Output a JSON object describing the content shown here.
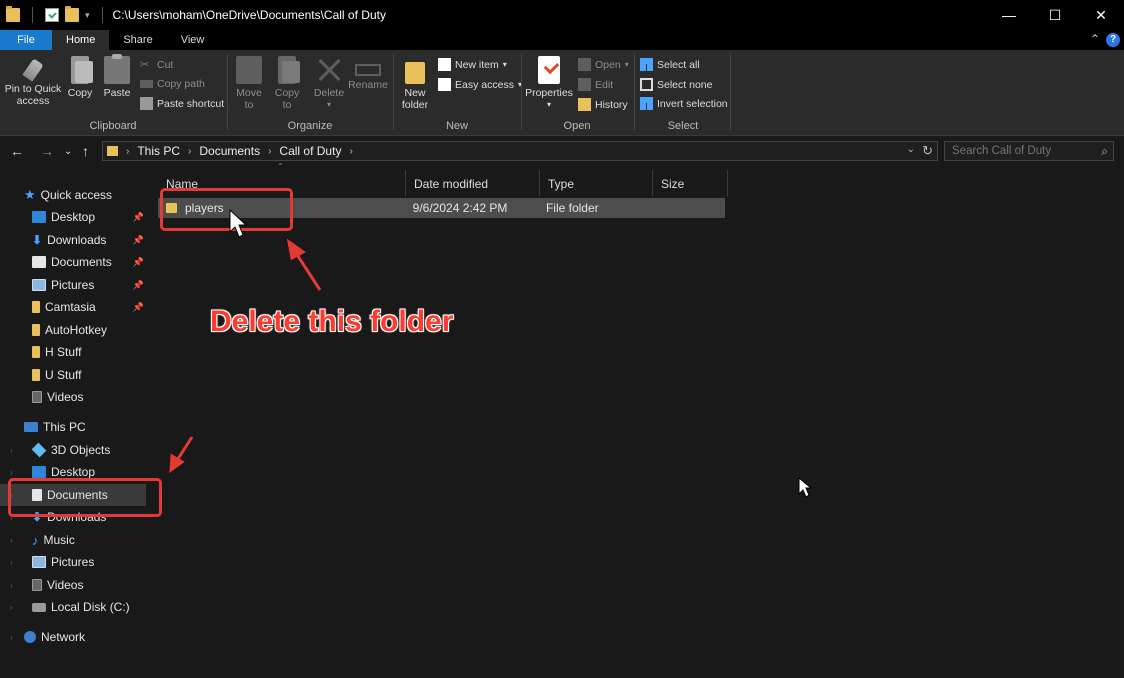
{
  "window": {
    "path": "C:\\Users\\moham\\OneDrive\\Documents\\Call of Duty",
    "controls": [
      "—",
      "☐",
      "✕"
    ]
  },
  "tabs": [
    "File",
    "Home",
    "Share",
    "View"
  ],
  "ribbon": {
    "clipboard": {
      "label": "Clipboard",
      "pin_line1": "Pin to Quick",
      "pin_line2": "access",
      "copy": "Copy",
      "paste": "Paste",
      "cut": "Cut",
      "copy_path": "Copy path",
      "paste_shortcut": "Paste shortcut"
    },
    "organize": {
      "label": "Organize",
      "move_line1": "Move",
      "move_line2": "to",
      "copy_line1": "Copy",
      "copy_line2": "to",
      "delete": "Delete",
      "rename": "Rename"
    },
    "new": {
      "label": "New",
      "folder_line1": "New",
      "folder_line2": "folder",
      "new_item": "New item",
      "easy_access": "Easy access"
    },
    "open": {
      "label": "Open",
      "properties": "Properties",
      "open": "Open",
      "edit": "Edit",
      "history": "History"
    },
    "select": {
      "label": "Select",
      "select_all": "Select all",
      "select_none": "Select none",
      "invert": "Invert selection"
    }
  },
  "address": {
    "crumbs": [
      "This PC",
      "Documents",
      "Call of Duty"
    ],
    "search_placeholder": "Search Call of Duty"
  },
  "nav": {
    "quick_access": "Quick access",
    "quick_items": [
      "Desktop",
      "Downloads",
      "Documents",
      "Pictures",
      "Camtasia",
      "AutoHotkey",
      "H Stuff",
      "U Stuff",
      "Videos"
    ],
    "this_pc": "This PC",
    "pc_items": [
      "3D Objects",
      "Desktop",
      "Documents",
      "Downloads",
      "Music",
      "Pictures",
      "Videos",
      "Local Disk (C:)"
    ],
    "network": "Network"
  },
  "columns": [
    "Name",
    "Date modified",
    "Type",
    "Size"
  ],
  "files": [
    {
      "name": "players",
      "modified": "9/6/2024 2:42 PM",
      "type": "File folder",
      "size": ""
    }
  ],
  "annotation": {
    "text": "Delete this folder",
    "color": "#e53935"
  },
  "colors": {
    "accent": "#1979ca",
    "background": "#191919",
    "ribbon": "#2b2b2b",
    "folder": "#e8c15a"
  }
}
